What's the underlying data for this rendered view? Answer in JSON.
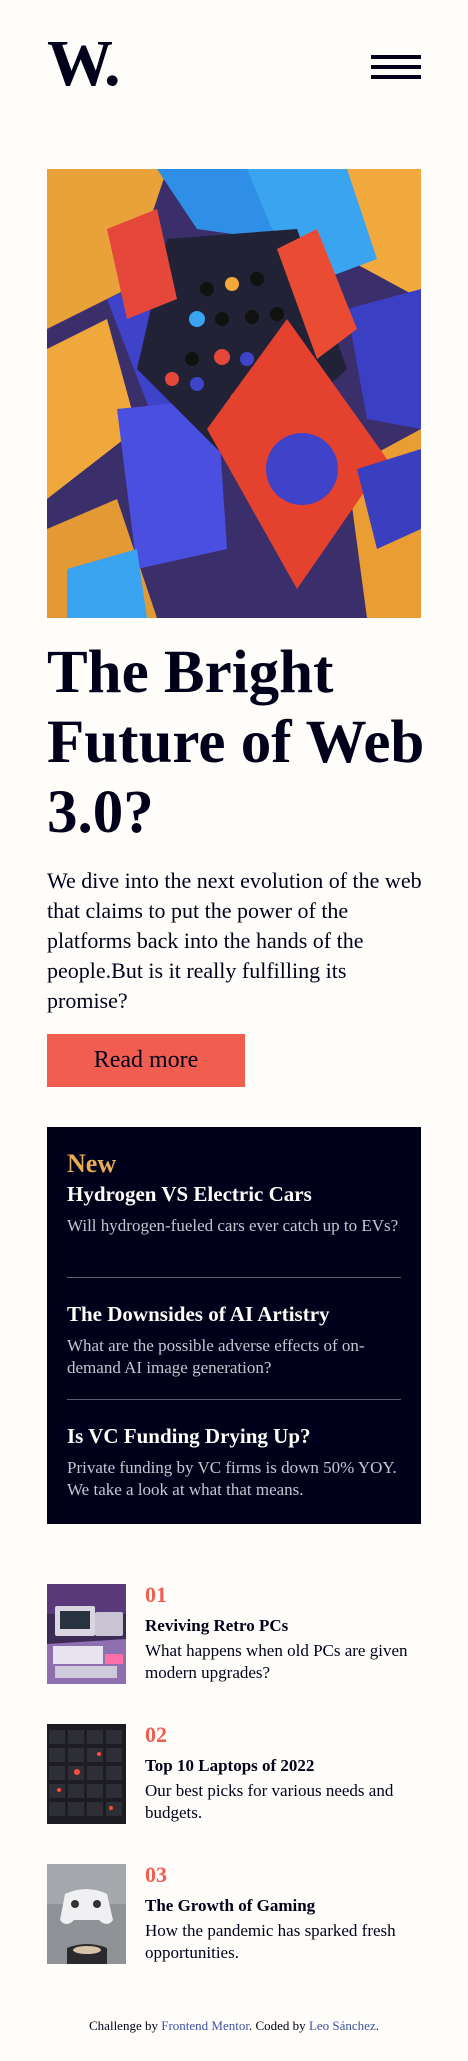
{
  "header": {
    "logo": "W.",
    "menu_icon": "hamburger-menu-icon"
  },
  "hero": {
    "image_icon": "abstract-3d-shapes-image",
    "title": "The Bright Future of Web 3.0?",
    "text": "We dive into the next evolution of the web that claims to put the power of the platforms back into the hands of the people.But is it really fulfilling its promise?",
    "button_label": "Read more"
  },
  "new_panel": {
    "heading": "New",
    "items": [
      {
        "title": "Hydrogen VS Electric Cars",
        "desc": "Will hydrogen-fueled cars ever catch up to EVs?"
      },
      {
        "title": "The Downsides of AI Artistry",
        "desc": "What are the possible adverse effects of on-demand AI image generation?"
      },
      {
        "title": "Is VC Funding Drying Up?",
        "desc": "Private funding by VC firms is down 50% YOY. We take a look at what that means."
      }
    ]
  },
  "articles": [
    {
      "number": "01",
      "title": "Reviving Retro PCs",
      "desc": "What happens when old PCs are given modern upgrades?",
      "image_icon": "retro-pc-image"
    },
    {
      "number": "02",
      "title": "Top 10 Laptops of 2022",
      "desc": "Our best picks for various needs and budgets.",
      "image_icon": "laptop-keyboard-image"
    },
    {
      "number": "03",
      "title": "The Growth of Gaming",
      "desc": "How the pandemic has sparked fresh opportunities.",
      "image_icon": "game-controller-image"
    }
  ],
  "footer": {
    "prefix": "Challenge by ",
    "link1": "Frontend Mentor",
    "middle": ". Coded by ",
    "link2": "Leo Sánchez",
    "suffix": "."
  },
  "colors": {
    "background": "#fffdfa",
    "dark": "#00001a",
    "accent_red": "#f15e50",
    "accent_orange": "#e9ab53",
    "link_blue": "#3e52a3"
  }
}
